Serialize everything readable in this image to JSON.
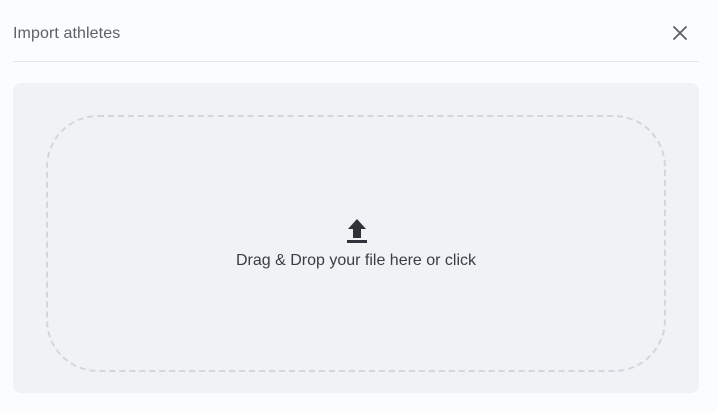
{
  "dialog": {
    "title": "Import athletes",
    "close_icon": "close-icon"
  },
  "upload": {
    "icon": "upload-icon",
    "instruction": "Drag & Drop your file here or click"
  },
  "colors": {
    "dialog_bg": "#fbfcfd",
    "panel_bg": "#f0f2f6",
    "dashed_border": "#d3d6db",
    "text": "#3a3d44",
    "title_text": "#5c6068"
  }
}
